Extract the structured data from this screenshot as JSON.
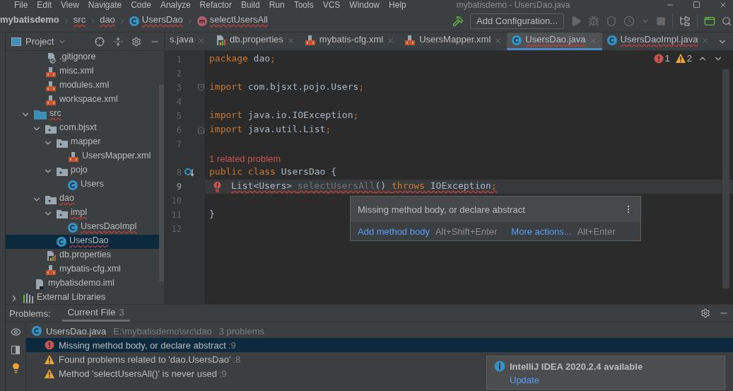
{
  "menu": {
    "items": [
      "File",
      "Edit",
      "View",
      "Navigate",
      "Code",
      "Analyze",
      "Refactor",
      "Build",
      "Run",
      "Tools",
      "VCS",
      "Window",
      "Help"
    ],
    "title": "mybatisdemo - UsersDao.java"
  },
  "breadcrumbs": [
    {
      "label": "mybatisdemo",
      "error": false
    },
    {
      "label": "src",
      "error": true
    },
    {
      "label": "dao",
      "error": true
    },
    {
      "label": "UsersDao",
      "kind": "class",
      "error": true
    },
    {
      "label": "selectUsersAll",
      "kind": "method",
      "error": true
    }
  ],
  "run_config": {
    "label": "Add Configuration..."
  },
  "project_panel": {
    "title": "Project"
  },
  "tree": [
    {
      "children": [
        {
          "children": [
            {
              "label": ".gitignore",
              "kind": "ignore",
              "error": false,
              "selected": false
            },
            {
              "label": "misc.xml",
              "kind": "xml",
              "error": false,
              "selected": false
            },
            {
              "label": "modules.xml",
              "kind": "xml",
              "error": false,
              "selected": false
            },
            {
              "label": "workspace.xml",
              "kind": "xml",
              "error": false,
              "selected": false
            }
          ]
        },
        {
          "label": "src",
          "kind": "source",
          "error": true,
          "selected": false,
          "expanded": true,
          "children": [
            {
              "label": "com.bjsxt",
              "kind": "package",
              "error": false,
              "selected": false,
              "expanded": true,
              "children": [
                {
                  "label": "mapper",
                  "kind": "package",
                  "error": false,
                  "selected": false,
                  "expanded": true,
                  "children": [
                    {
                      "label": "UsersMapper.xml",
                      "kind": "xml",
                      "error": false,
                      "selected": false
                    }
                  ]
                },
                {
                  "label": "pojo",
                  "kind": "package",
                  "error": false,
                  "selected": false,
                  "expanded": true,
                  "children": [
                    {
                      "label": "Users",
                      "kind": "class",
                      "error": false,
                      "selected": false
                    }
                  ]
                }
              ]
            },
            {
              "label": "dao",
              "kind": "package",
              "error": true,
              "selected": false,
              "expanded": true,
              "children": [
                {
                  "label": "impl",
                  "kind": "package",
                  "error": true,
                  "selected": false,
                  "expanded": true,
                  "children": [
                    {
                      "label": "UsersDaoImpl",
                      "kind": "class",
                      "error": true,
                      "selected": false
                    }
                  ]
                },
                {
                  "label": "UsersDao",
                  "kind": "class",
                  "error": true,
                  "selected": true
                }
              ]
            },
            {
              "label": "db.properties",
              "kind": "properties",
              "error": false,
              "selected": false
            },
            {
              "label": "mybatis-cfg.xml",
              "kind": "xml",
              "error": false,
              "selected": false
            }
          ]
        },
        {
          "label": "mybatisdemo.iml",
          "kind": "module",
          "error": false,
          "selected": false
        }
      ]
    },
    {
      "label": "External Libraries",
      "kind": "library",
      "error": false,
      "selected": false,
      "expanded": false
    }
  ],
  "editor_tabs": [
    {
      "label": "s.java",
      "error": false,
      "selected": false
    },
    {
      "label": "db.properties",
      "kind": "properties",
      "error": false,
      "selected": false
    },
    {
      "label": "mybatis-cfg.xml",
      "kind": "xml",
      "error": false,
      "selected": false
    },
    {
      "label": "UsersMapper.xml",
      "kind": "xml",
      "error": false,
      "selected": false
    },
    {
      "label": "UsersDao.java",
      "kind": "class",
      "error": true,
      "selected": true
    },
    {
      "label": "UsersDaoImpl.java",
      "kind": "class",
      "error": true,
      "selected": false
    }
  ],
  "inspection": {
    "errors": "1",
    "warnings": "2"
  },
  "code_lines": [
    {
      "number": "1",
      "tokens": [
        {
          "t": "package",
          "kind": "keyword"
        },
        {
          "t": " dao",
          "kind": "plain"
        },
        {
          "t": ";",
          "kind": "keyword"
        }
      ]
    },
    {
      "number": "2"
    },
    {
      "number": "3",
      "fold": {
        "kind": "start"
      },
      "tokens": [
        {
          "t": "import",
          "kind": "keyword"
        },
        {
          "t": " com.bjsxt.pojo.Users",
          "kind": "plain"
        },
        {
          "t": ";",
          "kind": "keyword"
        }
      ]
    },
    {
      "number": "4"
    },
    {
      "number": "5",
      "tokens": [
        {
          "t": "import",
          "kind": "keyword"
        },
        {
          "t": " java.io.IOException",
          "kind": "plain"
        },
        {
          "t": ";",
          "kind": "keyword"
        }
      ]
    },
    {
      "number": "6",
      "fold": {
        "kind": "end"
      },
      "tokens": [
        {
          "t": "import",
          "kind": "keyword"
        },
        {
          "t": " java.util.List",
          "kind": "plain"
        },
        {
          "t": ";",
          "kind": "keyword"
        }
      ]
    },
    {
      "number": "7"
    },
    {
      "number": "8",
      "hint": "1 related problem",
      "gutter": {
        "kind": "implemented"
      },
      "tokens": [
        {
          "t": "public class",
          "kind": "keyword"
        },
        {
          "t": " UsersDao {",
          "kind": "plain"
        }
      ]
    },
    {
      "number": "9",
      "current": true,
      "indented": true,
      "error": true,
      "gutter": {
        "kind": "error"
      },
      "tokens": [
        {
          "t": "List<Users> ",
          "kind": "plain"
        },
        {
          "t": "selectUsersAll",
          "kind": "unused"
        },
        {
          "t": "() ",
          "kind": "plain"
        },
        {
          "t": "throws",
          "kind": "keyword"
        },
        {
          "t": " IOException",
          "kind": "plain"
        },
        {
          "t": ";",
          "kind": "keyword"
        }
      ]
    },
    {
      "number": "10"
    },
    {
      "number": "11",
      "tokens": [
        {
          "t": "}",
          "kind": "plain"
        }
      ]
    },
    {
      "number": "12"
    }
  ],
  "popup": {
    "message": "Missing method body, or declare abstract",
    "actions": [
      {
        "label": "Add method body",
        "shortcut": "Alt+Shift+Enter"
      },
      {
        "label": "More actions...",
        "shortcut": "Alt+Enter"
      }
    ]
  },
  "problems": {
    "title": "Problems:",
    "tabs": [
      {
        "label": "Current File",
        "count": "3",
        "selected": true
      }
    ],
    "file": {
      "name": "UsersDao.java",
      "path": "E:\\mybatisdemo\\src\\dao",
      "summary": "3 problems"
    },
    "items": [
      {
        "kind": "error",
        "text": "Missing method body, or declare abstract",
        "line": ":9",
        "selected": true
      },
      {
        "kind": "warning",
        "text": "Found problems related to 'dao.UsersDao'",
        "line": ":8",
        "selected": false
      },
      {
        "kind": "warning",
        "text": "Method 'selectUsersAll()' is never used",
        "line": ":9",
        "selected": false
      }
    ]
  },
  "notification": {
    "title": "IntelliJ IDEA 2020.2.4 available",
    "link": "Update"
  }
}
